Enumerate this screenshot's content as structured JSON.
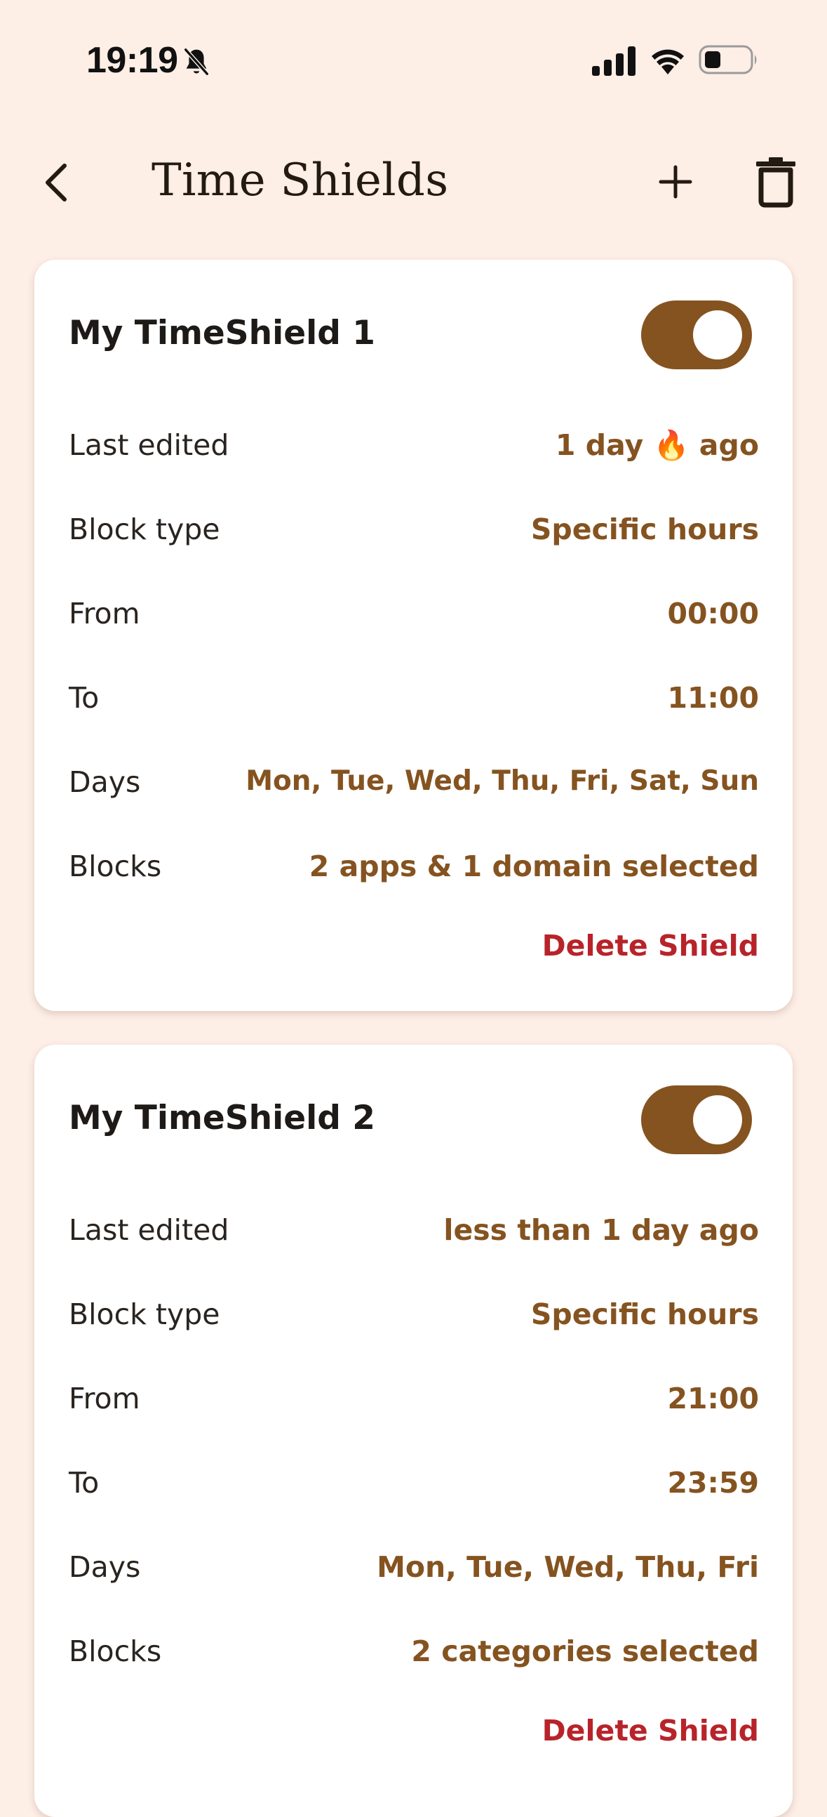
{
  "status_bar": {
    "time": "19:19"
  },
  "header": {
    "title": "Time Shields"
  },
  "colors": {
    "background": "#fdeee6",
    "accent": "#855320",
    "danger": "#b8232a",
    "card": "#ffffff"
  },
  "shields": [
    {
      "name": "My TimeShield 1",
      "enabled": true,
      "rows": [
        {
          "label": "Last edited",
          "value": "1 day 🔥 ago"
        },
        {
          "label": "Block type",
          "value": "Specific hours"
        },
        {
          "label": "From",
          "value": "00:00"
        },
        {
          "label": "To",
          "value": "11:00"
        },
        {
          "label": "Days",
          "value": "Mon, Tue, Wed, Thu, Fri, Sat, Sun"
        },
        {
          "label": "Blocks",
          "value": "2 apps & 1 domain selected"
        }
      ],
      "delete_label": "Delete Shield"
    },
    {
      "name": "My TimeShield 2",
      "enabled": true,
      "rows": [
        {
          "label": "Last edited",
          "value": "less than 1 day ago"
        },
        {
          "label": "Block type",
          "value": "Specific hours"
        },
        {
          "label": "From",
          "value": "21:00"
        },
        {
          "label": "To",
          "value": "23:59"
        },
        {
          "label": "Days",
          "value": "Mon, Tue, Wed, Thu, Fri"
        },
        {
          "label": "Blocks",
          "value": "2 categories selected"
        }
      ],
      "delete_label": "Delete Shield"
    }
  ],
  "icons": {
    "status": [
      "bell-off-icon",
      "cellular-signal-icon",
      "wifi-icon",
      "battery-icon"
    ],
    "header": [
      "back-chevron-icon",
      "plus-icon",
      "trash-icon"
    ]
  }
}
